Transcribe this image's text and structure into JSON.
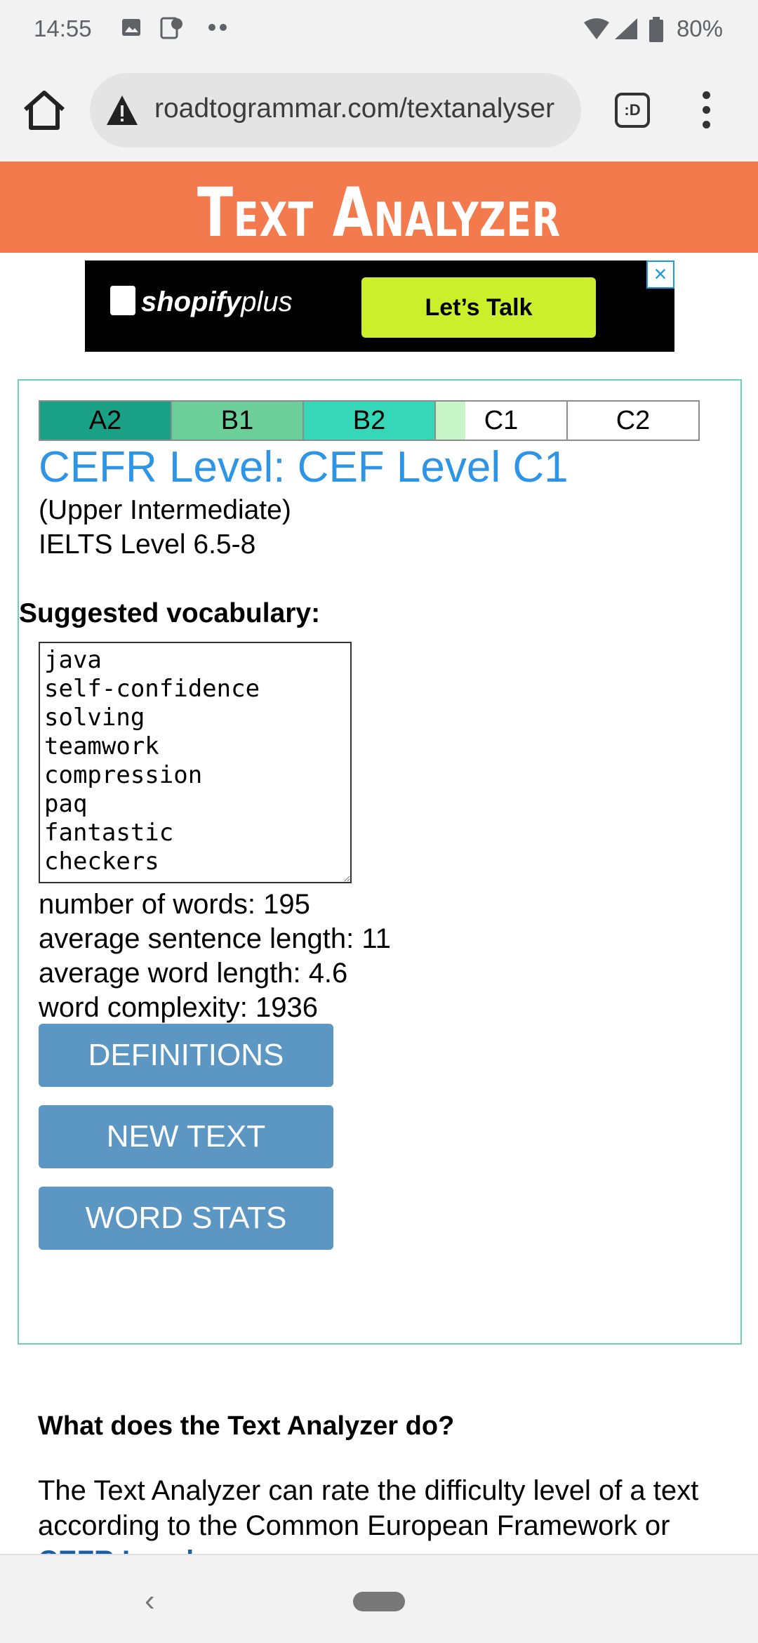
{
  "status_bar": {
    "time": "14:55",
    "battery": "80%"
  },
  "browser": {
    "url": "roadtogrammar.com/textanalyser",
    "tabs_label": ":D"
  },
  "site": {
    "title": "Text Analyzer"
  },
  "ad": {
    "brand_bold": "shopify",
    "brand_light": "plus",
    "cta": "Let’s Talk",
    "close": "×"
  },
  "levels": [
    "A2",
    "B1",
    "B2",
    "C1",
    "C2"
  ],
  "result": {
    "cefr": "CEFR Level: CEF Level C1",
    "description": "(Upper Intermediate)",
    "ielts": "IELTS Level 6.5-8",
    "vocab_label": "Suggested vocabulary:",
    "vocab": "java\nself-confidence\nsolving\nteamwork\ncompression\npaq\nfantastic\ncheckers",
    "stats": [
      "number of words: 195",
      "average sentence length: 11",
      "average word length: 4.6",
      "word complexity: 1936"
    ]
  },
  "buttons": {
    "definitions": "DEFINITIONS",
    "new_text": "NEW TEXT",
    "word_stats": "WORD STATS"
  },
  "faq": {
    "heading": "What does the Text Analyzer do?",
    "body_start": "The Text Analyzer can rate the difficulty level of a text according to the Common European Framework or",
    "link": "CEFR Level",
    "body_end": "."
  },
  "colors": {
    "header": "#f27a4d",
    "cefr_title": "#2e95e6",
    "button": "#5b97c2",
    "panel_border": "#6fcfb6"
  }
}
